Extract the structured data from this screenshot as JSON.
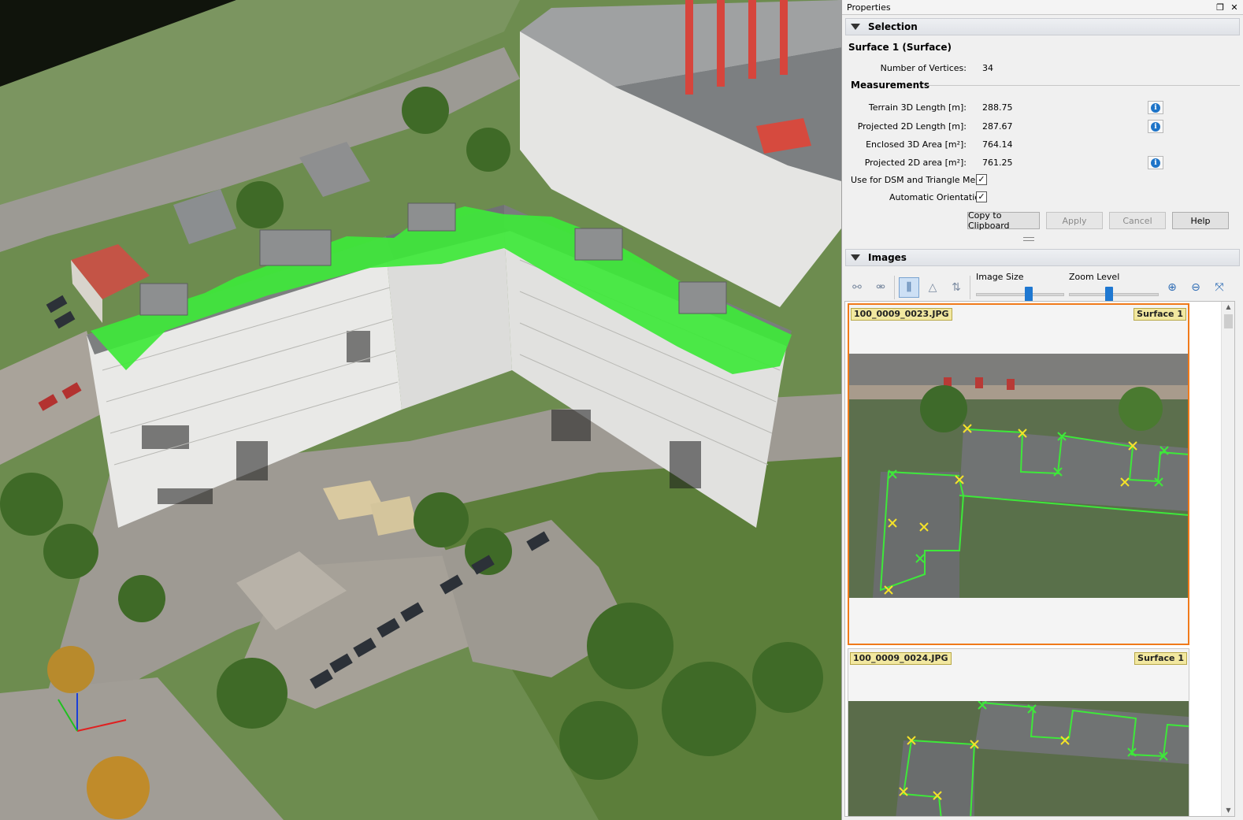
{
  "properties": {
    "title": "Properties",
    "restore_icon": "restore-window-icon",
    "close_icon": "close-icon",
    "selection": {
      "header": "Selection",
      "object_title": "Surface 1 (Surface)",
      "vertices_label": "Number of Vertices:",
      "vertices_value": "34",
      "measurements_header": "Measurements",
      "rows": [
        {
          "label": "Terrain 3D Length [m]:",
          "value": "288.75",
          "info": true
        },
        {
          "label": "Projected 2D Length [m]:",
          "value": "287.67",
          "info": true
        },
        {
          "label": "Enclosed 3D Area [m²]:",
          "value": "764.14",
          "info": false
        },
        {
          "label": "Projected 2D area [m²]:",
          "value": "761.25",
          "info": true
        }
      ],
      "use_dsm_label": "Use for DSM and Triangle Mesh",
      "use_dsm_checked": true,
      "auto_orient_label": "Automatic Orientation",
      "auto_orient_checked": true,
      "buttons": {
        "copy": "Copy to Clipboard",
        "apply": "Apply",
        "cancel": "Cancel",
        "help": "Help"
      }
    },
    "images": {
      "header": "Images",
      "image_size_label": "Image Size",
      "zoom_level_label": "Zoom Level",
      "image_size_value": 0.6,
      "zoom_level_value": 0.45,
      "tools": [
        "link-icon",
        "unlink-icon",
        "sort-columns-icon",
        "sort-triangle-icon",
        "sort-alpha-icon",
        "zoom-in-icon",
        "zoom-out-icon",
        "fit-icon"
      ],
      "cards": [
        {
          "file": "100_0009_0023.JPG",
          "surface": "Surface 1",
          "selected": true
        },
        {
          "file": "100_0009_0024.JPG",
          "surface": "Surface 1",
          "selected": false
        }
      ]
    }
  },
  "colors": {
    "accent": "#f07a1a",
    "surface_green": "#3ee83a",
    "info_blue": "#1e74c8",
    "slider_blue": "#1f78d1",
    "tag_yellow": "#f2e8a0"
  }
}
